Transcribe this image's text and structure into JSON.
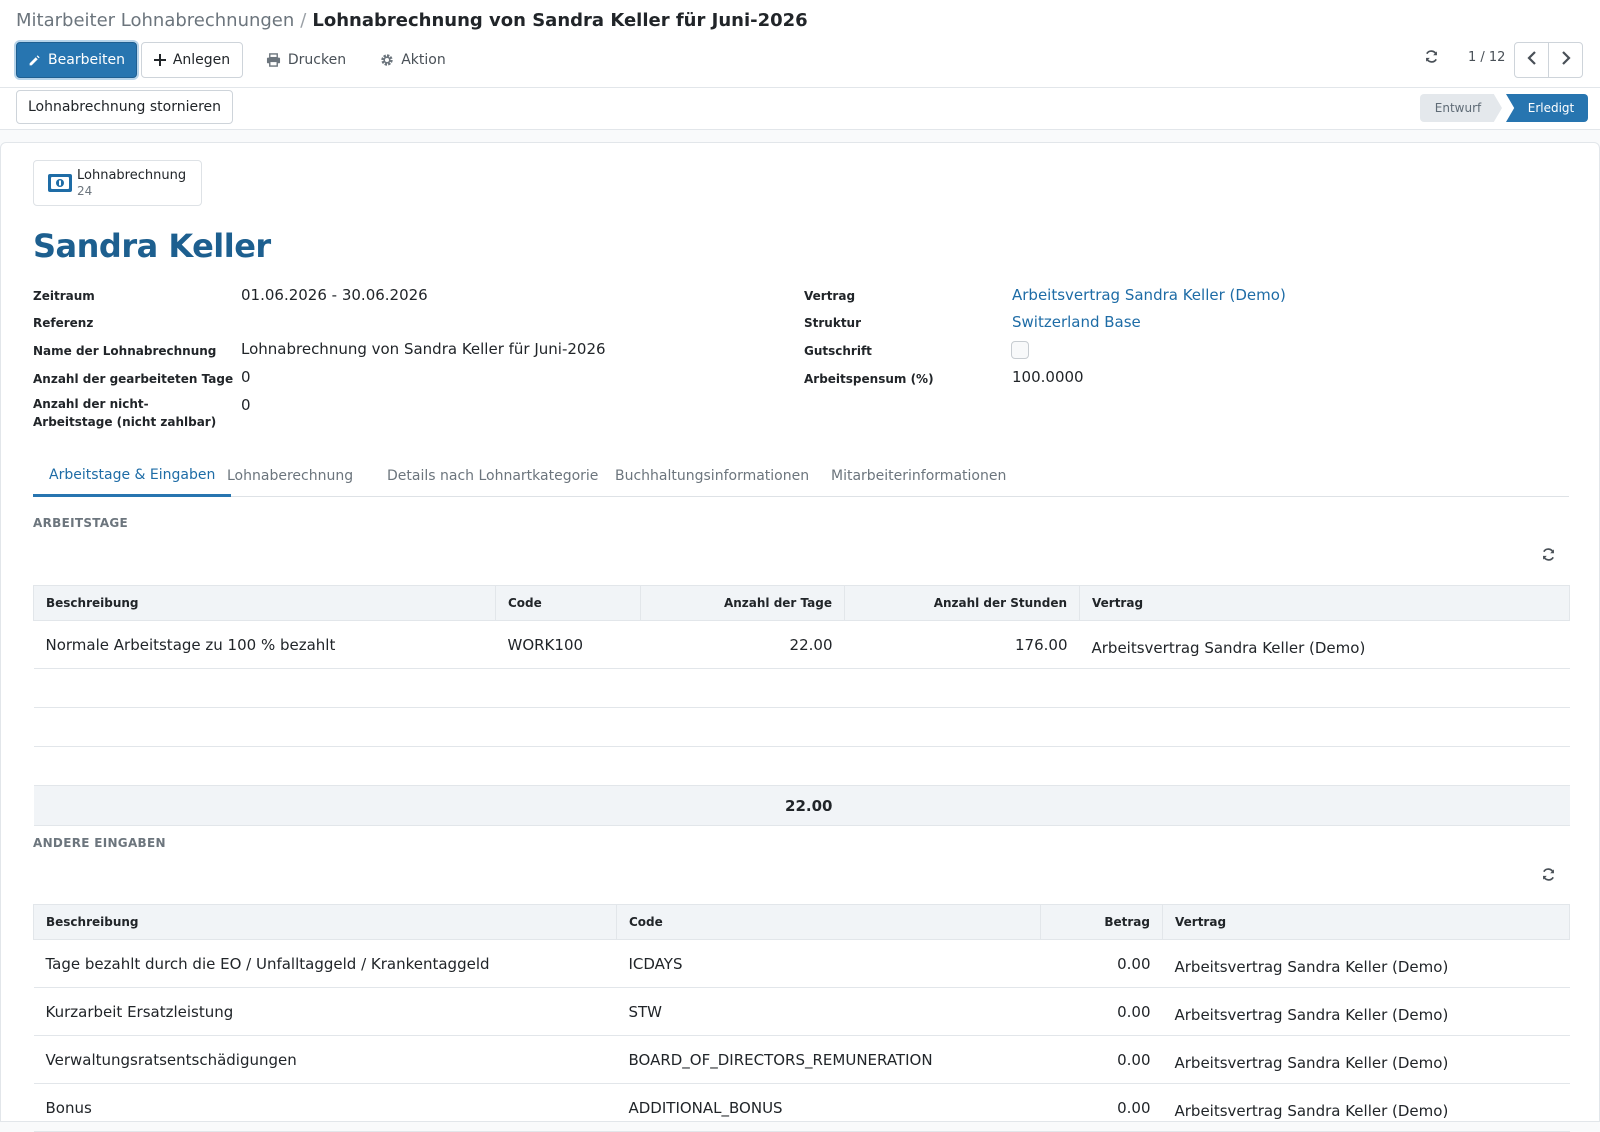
{
  "breadcrumb": {
    "parent": "Mitarbeiter Lohnabrechnungen",
    "separator": "/",
    "current": "Lohnabrechnung von Sandra Keller für Juni-2026"
  },
  "toolbar": {
    "edit_label": "Bearbeiten",
    "create_label": "Anlegen",
    "print_label": "Drucken",
    "action_label": "Aktion",
    "pager": "1 / 12"
  },
  "statusbar": {
    "cancel_label": "Lohnabrechnung stornieren",
    "states": [
      "Entwurf",
      "Erledigt"
    ],
    "active_state": "Erledigt"
  },
  "smart_button": {
    "label": "Lohnabrechnung",
    "value": "24",
    "icon": "money-icon"
  },
  "employee": {
    "name": "Sandra Keller"
  },
  "fields_left": [
    {
      "label": "Zeitraum",
      "value": "01.06.2026 - 30.06.2026"
    },
    {
      "label": "Referenz",
      "value": ""
    },
    {
      "label": "Name der Lohnabrechnung",
      "value": "Lohnabrechnung von Sandra Keller für Juni-2026"
    },
    {
      "label": "Anzahl der gearbeiteten Tage",
      "value": "0"
    },
    {
      "label": "Anzahl der nicht-Arbeitstage (nicht zahlbar)",
      "value": "0"
    }
  ],
  "fields_right": [
    {
      "label": "Vertrag",
      "value": "Arbeitsvertrag Sandra Keller (Demo)"
    },
    {
      "label": "Struktur",
      "value": "Switzerland Base"
    },
    {
      "label": "Gutschrift",
      "value": false
    },
    {
      "label": "Arbeitspensum (%)",
      "value": "100.0000"
    }
  ],
  "tabs": [
    "Arbeitstage & Eingaben",
    "Lohnaberechnung",
    "Details nach Lohnartkategorie",
    "Buchhaltungsinformationen",
    "Mitarbeiterinformationen"
  ],
  "active_tab": "Arbeitstage & Eingaben",
  "worked_days": {
    "title": "ARBEITSTAGE",
    "columns": [
      "Beschreibung",
      "Code",
      "Anzahl der Tage",
      "Anzahl der Stunden",
      "Vertrag"
    ],
    "rows": [
      [
        "Normale Arbeitstage zu 100 % bezahlt",
        "WORK100",
        "22.00",
        "176.00",
        "Arbeitsvertrag Sandra Keller (Demo)"
      ]
    ],
    "total_days": "22.00"
  },
  "other_inputs": {
    "title": "ANDERE EINGABEN",
    "columns": [
      "Beschreibung",
      "Code",
      "Betrag",
      "Vertrag"
    ],
    "rows": [
      [
        "Tage bezahlt durch die EO / Unfalltaggeld / Krankentaggeld",
        "ICDAYS",
        "0.00",
        "Arbeitsvertrag Sandra Keller (Demo)"
      ],
      [
        "Kurzarbeit Ersatzleistung",
        "STW",
        "0.00",
        "Arbeitsvertrag Sandra Keller (Demo)"
      ],
      [
        "Verwaltungsratsentschädigungen",
        "BOARD_OF_DIRECTORS_REMUNERATION",
        "0.00",
        "Arbeitsvertrag Sandra Keller (Demo)"
      ],
      [
        "Bonus",
        "ADDITIONAL_BONUS",
        "0.00",
        "Arbeitsvertrag Sandra Keller (Demo)"
      ]
    ]
  },
  "colors": {
    "primary": "#2775b0",
    "link": "#1e6ca6",
    "title": "#1d5f8f"
  }
}
